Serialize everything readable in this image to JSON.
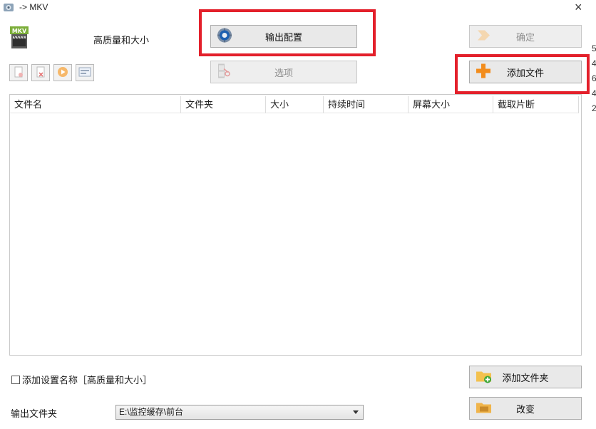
{
  "window": {
    "title": "-> MKV",
    "close_glyph": "×"
  },
  "header": {
    "app_icon": "mkv-file-icon",
    "app_icon_text": "MKV",
    "profile_name": "高质量和大小"
  },
  "buttons": {
    "output_config": "输出配置",
    "options": "选项",
    "ok": "确定",
    "add_file": "添加文件",
    "add_folder": "添加文件夹",
    "change": "改变"
  },
  "toolbar": {
    "icons": [
      "remove-file-icon",
      "delete-file-icon",
      "play-icon",
      "media-info-icon"
    ]
  },
  "table": {
    "columns": [
      "文件名",
      "文件夹",
      "大小",
      "持续时间",
      "屏幕大小",
      "截取片断"
    ],
    "rows": []
  },
  "footer": {
    "add_setting_name_label": "添加设置名称［高质量和大小］",
    "add_setting_name_checked": false,
    "output_folder_label": "输出文件夹",
    "output_folder_value": "E:\\监控缓存\\前台"
  },
  "edge_text": [
    "5",
    "4",
    "6",
    "4",
    "2"
  ],
  "colors": {
    "highlight": "#e3202b",
    "add_icon": "#f28c1c",
    "button_bg": "#e9e9e9"
  }
}
